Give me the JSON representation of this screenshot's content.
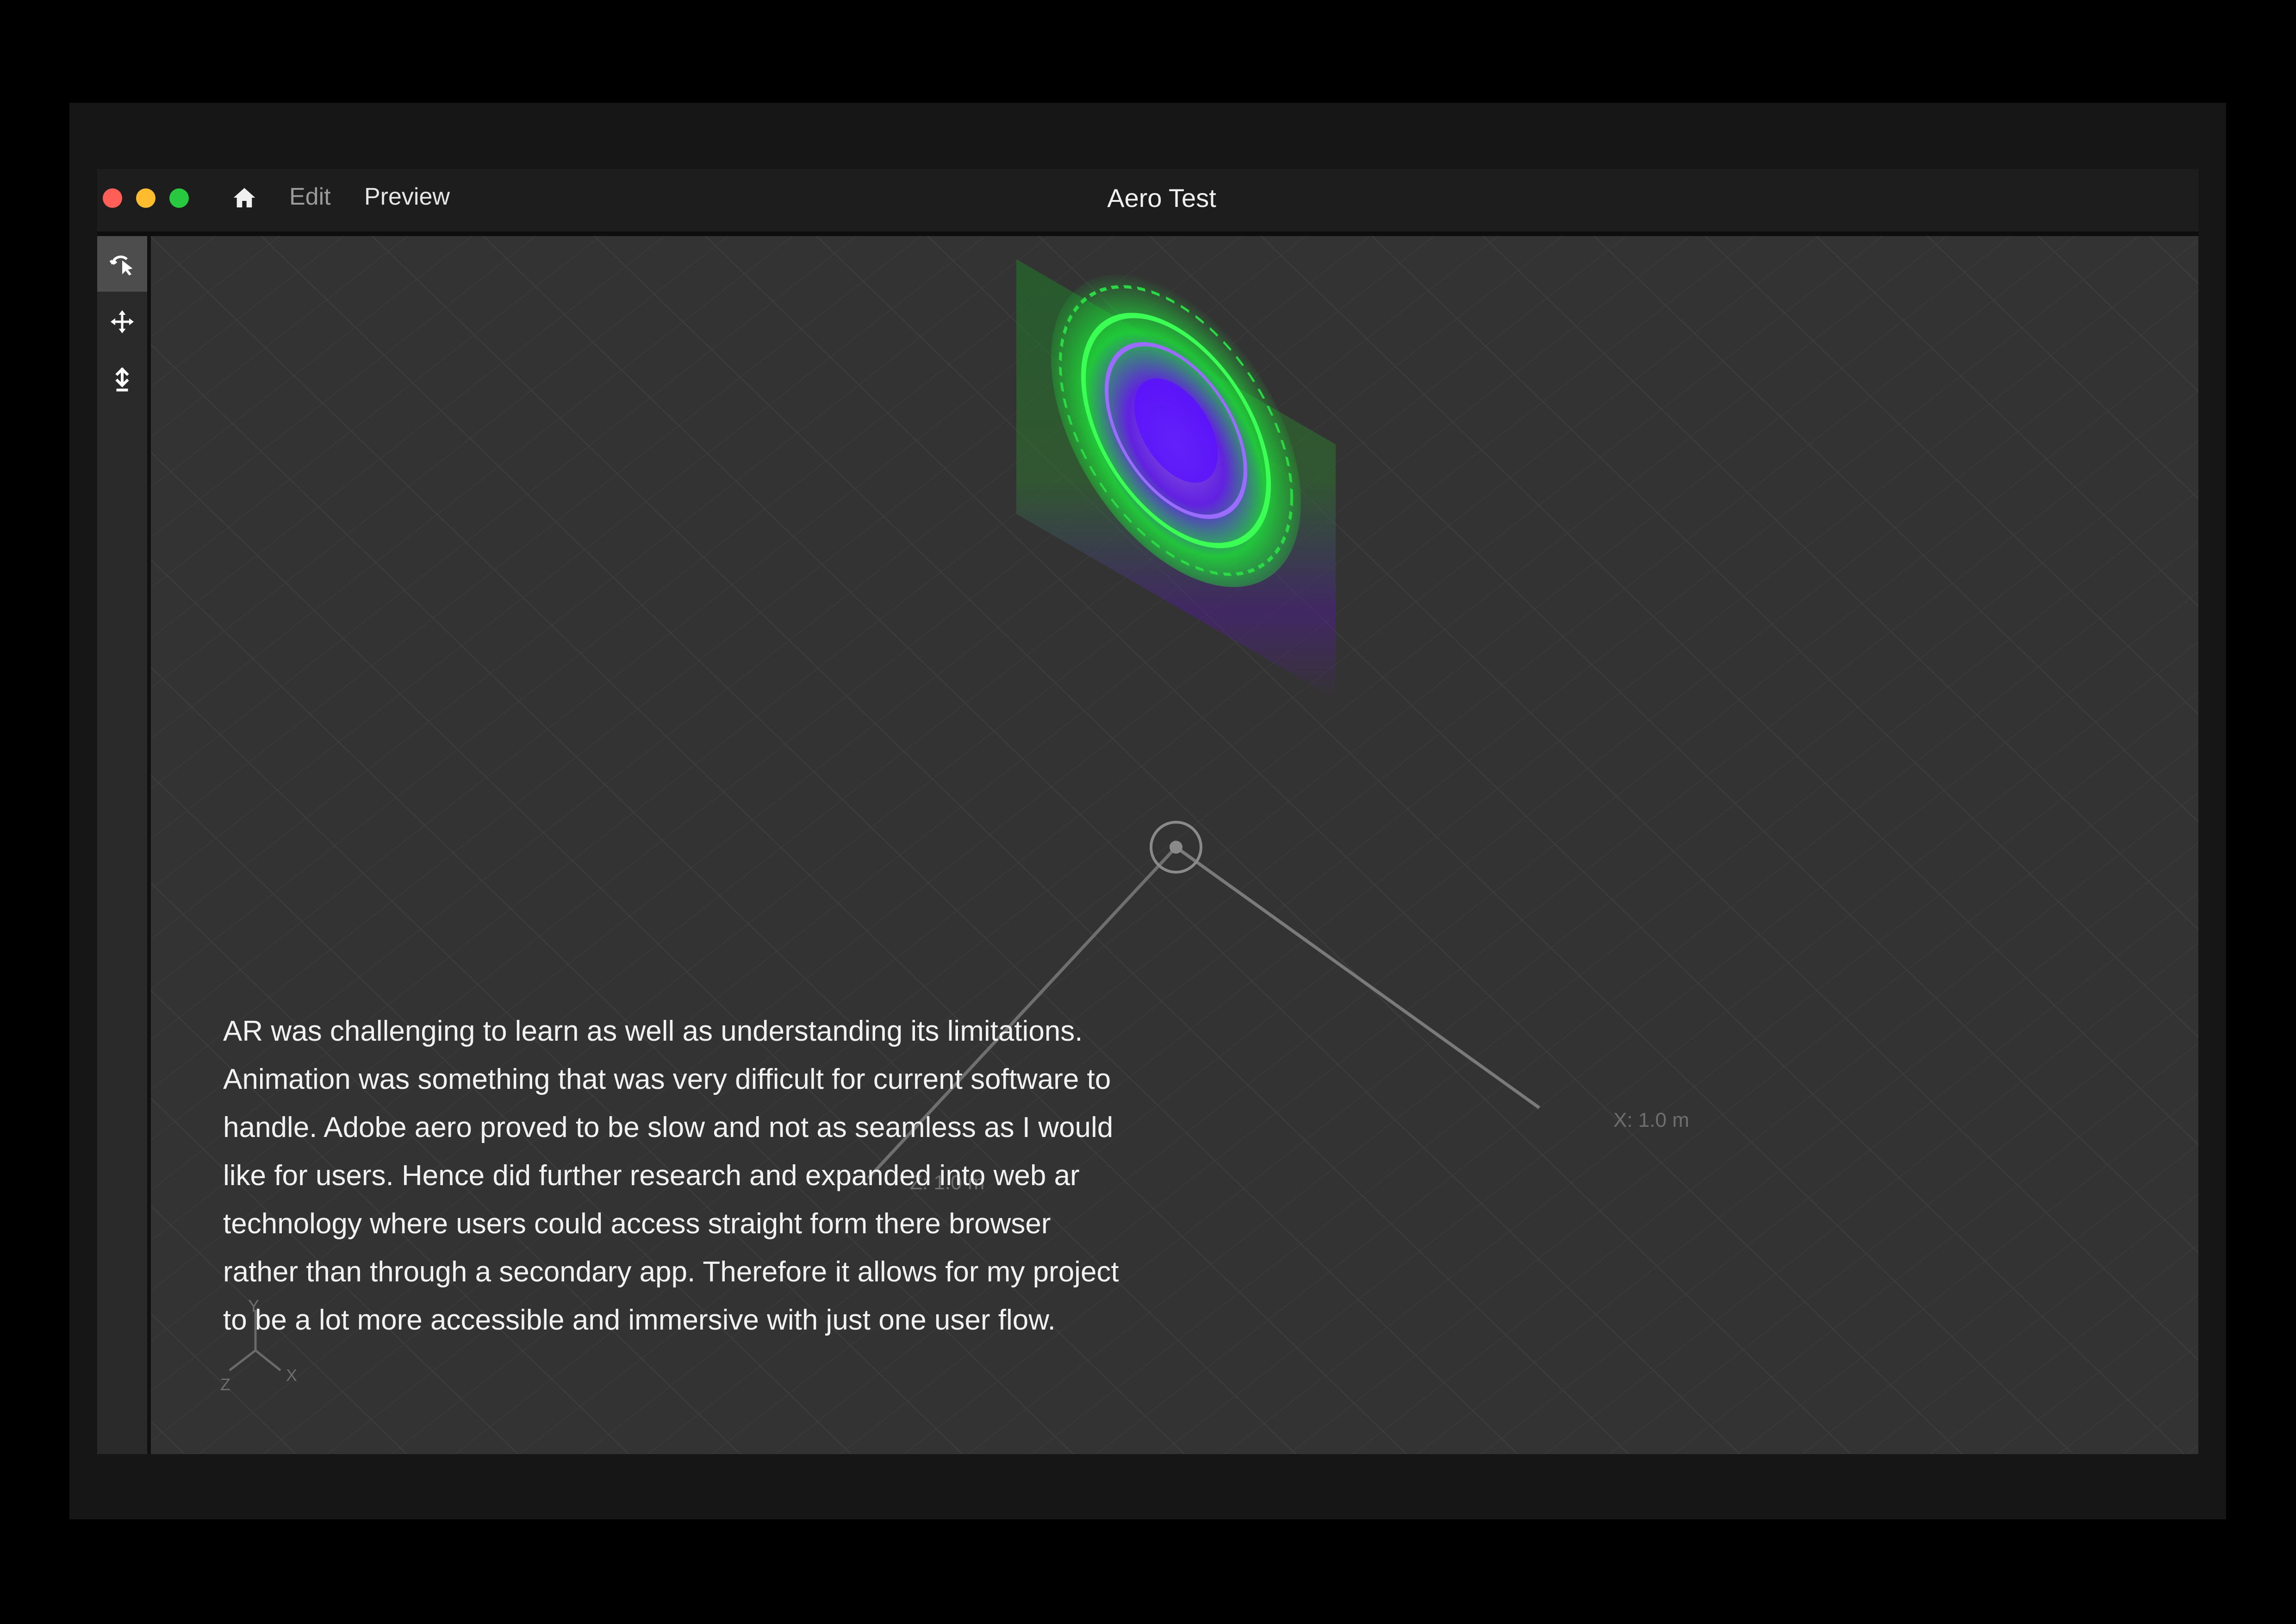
{
  "window": {
    "title": "Aero Test",
    "menu": {
      "edit": "Edit",
      "preview": "Preview"
    },
    "traffic_lights": {
      "close": "#ff5f57",
      "minimize": "#febc2e",
      "maximize": "#28c840"
    }
  },
  "toolbar": {
    "tools": [
      {
        "icon": "select-icon",
        "active": true
      },
      {
        "icon": "move-icon",
        "active": false
      },
      {
        "icon": "drop-to-ground-icon",
        "active": false
      }
    ]
  },
  "viewport": {
    "x_axis_label": "X: 1.0 m",
    "z_axis_label": "Z: 1.0 m",
    "gizmo_labels": {
      "y": "Y",
      "x": "X",
      "z": "Z"
    },
    "object": "mandala-plane",
    "object_colors": [
      "#22ff33",
      "#7a22ff",
      "#ff3388"
    ]
  },
  "caption": {
    "text": "AR was challenging to learn as well as understanding its limitations. Animation was something that was very difficult for current software to handle. Adobe aero proved to be slow and not as seamless as I would like for users. Hence did further research and expanded into web ar technology where users could access straight form there browser rather than through a secondary app. Therefore it allows for my project to be a lot more accessible and immersive with just one user flow."
  }
}
